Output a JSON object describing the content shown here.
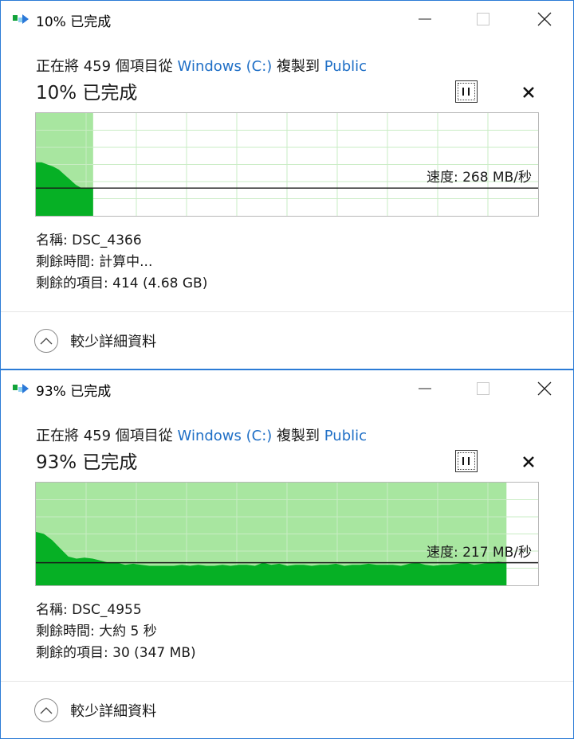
{
  "colors": {
    "accent_link": "#1f6fc6",
    "window_border": "#2b7bd6",
    "progress_fill_light": "#a8e6a0",
    "transfer_fill": "#06b025",
    "grid_line": "#c9ecc4",
    "speed_line": "#1a1a1a"
  },
  "dialogs": [
    {
      "title": "10% 已完成",
      "desc_prefix": "正在將 459 個項目從",
      "source_link": "Windows (C:)",
      "desc_middle": "複製到",
      "dest_link": "Public",
      "percent_heading": "10% 已完成",
      "progress_fraction": 0.114,
      "speed_label": "速度: 268 MB/秒",
      "speed_level_fraction": 0.27,
      "speed_history": [
        0.52,
        0.52,
        0.5,
        0.48,
        0.45,
        0.4,
        0.35,
        0.3,
        0.27,
        0.27,
        0.27
      ],
      "details": {
        "name": "名稱: DSC_4366",
        "time_remaining": "剩餘時間: 計算中...",
        "items_remaining": "剩餘的項目: 414 (4.68 GB)"
      },
      "footer_label": "較少詳細資料",
      "icons": {
        "app": "copy-progress-icon",
        "minimize": "minimize-icon",
        "maximize": "maximize-icon",
        "close": "close-icon",
        "pause": "pause-icon",
        "cancel": "cancel-icon",
        "collapse": "chevron-up-icon"
      }
    },
    {
      "title": "93% 已完成",
      "desc_prefix": "正在將 459 個項目從",
      "source_link": "Windows (C:)",
      "desc_middle": "複製到",
      "dest_link": "Public",
      "percent_heading": "93% 已完成",
      "progress_fraction": 0.937,
      "speed_label": "速度: 217 MB/秒",
      "speed_level_fraction": 0.22,
      "speed_history": [
        0.52,
        0.5,
        0.44,
        0.36,
        0.28,
        0.26,
        0.27,
        0.26,
        0.24,
        0.22,
        0.22,
        0.2,
        0.21,
        0.2,
        0.19,
        0.19,
        0.19,
        0.19,
        0.2,
        0.19,
        0.2,
        0.19,
        0.19,
        0.2,
        0.19,
        0.2,
        0.2,
        0.19,
        0.22,
        0.2,
        0.21,
        0.19,
        0.2,
        0.2,
        0.19,
        0.2,
        0.2,
        0.21,
        0.19,
        0.2,
        0.2,
        0.21,
        0.2,
        0.2,
        0.2,
        0.19,
        0.21,
        0.22,
        0.2,
        0.19,
        0.2,
        0.2,
        0.21,
        0.22,
        0.2,
        0.21,
        0.22,
        0.23,
        0.22
      ],
      "details": {
        "name": "名稱: DSC_4955",
        "time_remaining": "剩餘時間: 大約 5 秒",
        "items_remaining": "剩餘的項目: 30 (347 MB)"
      },
      "footer_label": "較少詳細資料",
      "icons": {
        "app": "copy-progress-icon",
        "minimize": "minimize-icon",
        "maximize": "maximize-icon",
        "close": "close-icon",
        "pause": "pause-icon",
        "cancel": "cancel-icon",
        "collapse": "chevron-up-icon"
      }
    }
  ]
}
